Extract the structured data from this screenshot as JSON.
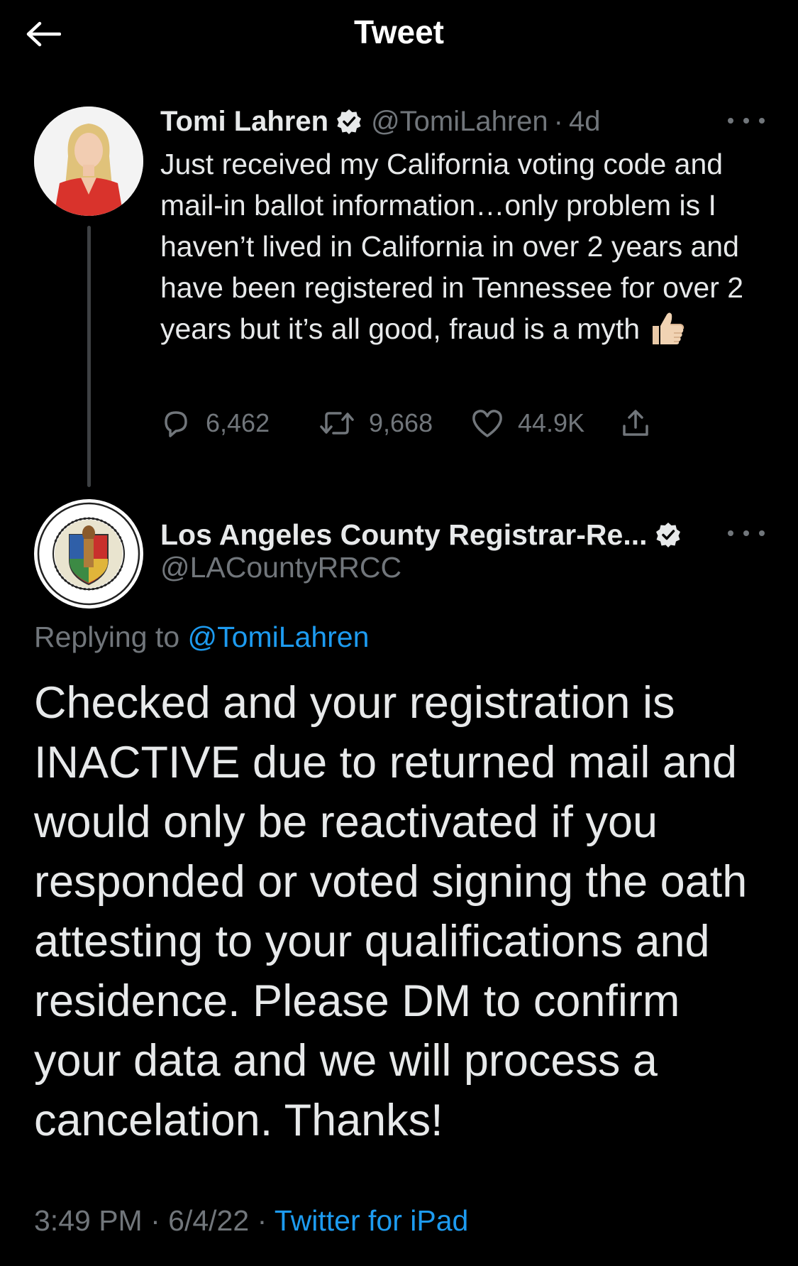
{
  "header": {
    "title": "Tweet",
    "back_icon": "arrow-left-icon"
  },
  "tweet": {
    "author": {
      "name": "Tomi Lahren",
      "handle": "@TomiLahren",
      "verified": true
    },
    "separator": "·",
    "time_ago": "4d",
    "text": "Just received my California voting code and mail-in ballot information…only problem is I haven’t lived in California in over 2 years and have been registered in Tennessee for over 2 years but it’s all good, fraud is a myth",
    "emoji": "thumbs-up-icon",
    "stats": {
      "replies": "6,462",
      "retweets": "9,668",
      "likes": "44.9K"
    }
  },
  "reply": {
    "author": {
      "name": "Los Angeles County Registrar-Re...",
      "handle": "@LACountyRRCC",
      "verified": true
    },
    "replying_prefix": "Replying to",
    "replying_to": "@TomiLahren",
    "text": "Checked and your registration is INACTIVE due to returned mail and would only be reactivated if you responded or voted signing the oath attesting to your qualifications and residence. Please DM to confirm your data and we will process a cancelation. Thanks!",
    "time": "3:49 PM",
    "separator": "·",
    "date": "6/4/22",
    "source": "Twitter for iPad"
  },
  "colors": {
    "background": "#000000",
    "text": "#e7e9ea",
    "secondary": "#71767b",
    "link": "#1d9bf0"
  }
}
